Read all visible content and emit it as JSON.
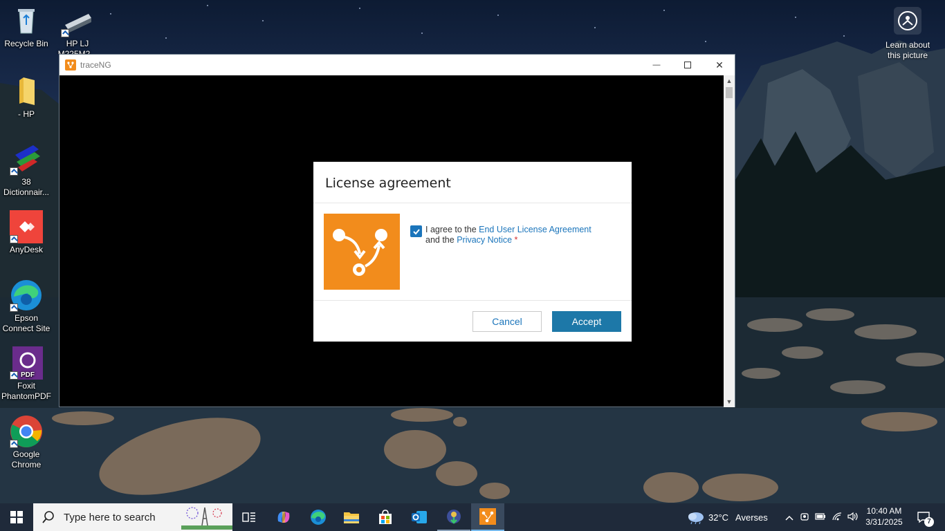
{
  "desktop": {
    "icons": [
      {
        "label": "Recycle Bin"
      },
      {
        "label": "HP LJ M225M2..."
      },
      {
        "label": "- HP"
      },
      {
        "label": "38 Dictionnair..."
      },
      {
        "label": "AnyDesk"
      },
      {
        "label": "Epson Connect Site"
      },
      {
        "label": "Foxit PhantomPDF"
      },
      {
        "label": "Google Chrome"
      }
    ],
    "learn_label": "Learn about this picture"
  },
  "window": {
    "title": "traceNG",
    "minimize_symbol": "—",
    "close_symbol": "✕"
  },
  "dialog": {
    "title": "License agreement",
    "agree_prefix": "I agree to the ",
    "eula_link": "End User License Agreement",
    "and_the": "and the ",
    "privacy_link": "Privacy Notice",
    "required_mark": " *",
    "checked": true,
    "cancel_label": "Cancel",
    "accept_label": "Accept"
  },
  "taskbar": {
    "search_placeholder": "Type here to search",
    "weather_temp": "32°C",
    "weather_location": "Averses",
    "time": "10:40 AM",
    "date": "3/31/2025",
    "notification_count": "7"
  },
  "colors": {
    "accent": "#1d78a8",
    "logo_orange": "#f28c1c",
    "link": "#1b75bb"
  }
}
